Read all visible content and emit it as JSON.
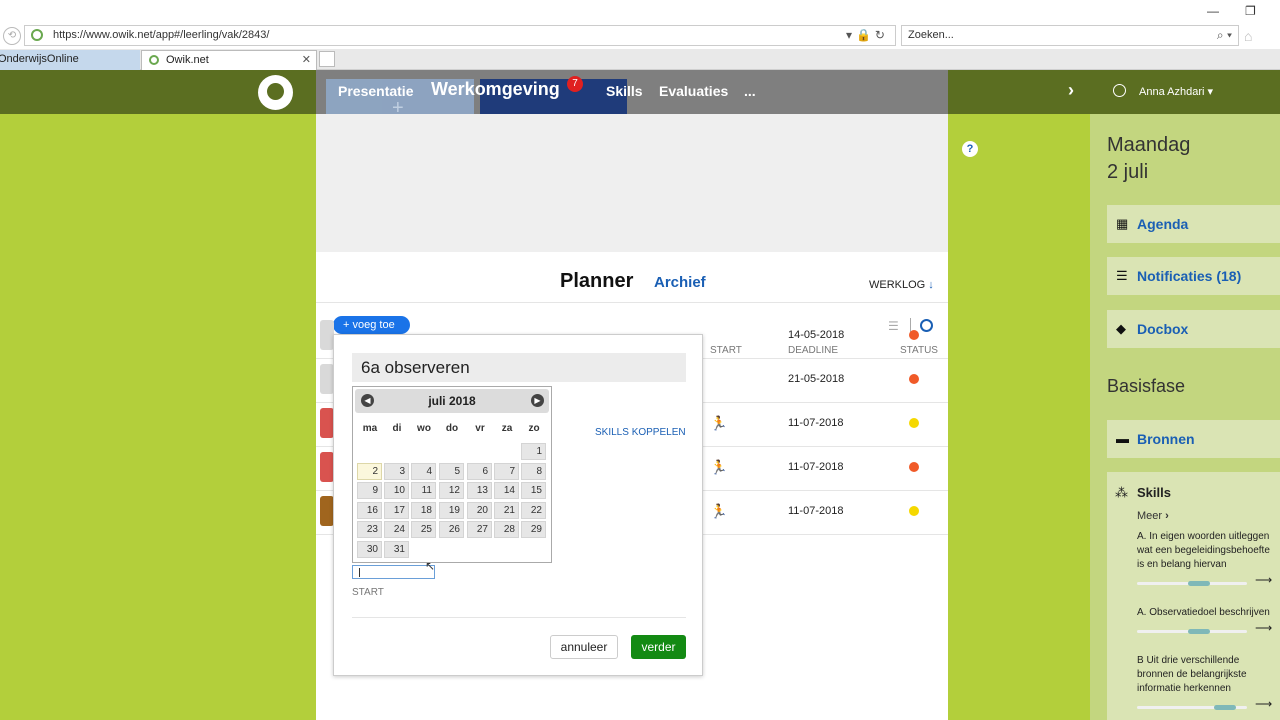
{
  "browser": {
    "url": "https://www.owik.net/app#/leerling/vak/2843/",
    "search_placeholder": "Zoeken...",
    "tabs": [
      {
        "label": "OnderwijsOnline"
      },
      {
        "label": "Owik.net"
      }
    ]
  },
  "nav": {
    "items": [
      "Presentatie",
      "Werkomgeving",
      "Skills",
      "Evaluaties",
      "..."
    ],
    "badge": "7"
  },
  "user": {
    "name": "Anna Azhdari"
  },
  "planner": {
    "title": "Planner",
    "archive": "Archief",
    "werklog": "WERKLOG",
    "add_button": "+ voeg toe",
    "columns": {
      "start": "START",
      "deadline": "DEADLINE",
      "status": "STATUS"
    },
    "rows": [
      {
        "deadline": "14-05-2018",
        "status_color": "#f05a28",
        "runner": false
      },
      {
        "deadline": "21-05-2018",
        "status_color": "#f05a28",
        "runner": false
      },
      {
        "deadline": "11-07-2018",
        "status_color": "#f5d800",
        "runner": true
      },
      {
        "deadline": "11-07-2018",
        "status_color": "#f05a28",
        "runner": true
      },
      {
        "deadline": "11-07-2018",
        "status_color": "#f5d800",
        "runner": true
      }
    ]
  },
  "modal": {
    "title_value": "6a observeren",
    "skills_link": "SKILLS KOPPELEN",
    "start_label": "START",
    "cancel": "annuleer",
    "next": "verder",
    "calendar": {
      "month": "juli 2018",
      "dow": [
        "ma",
        "di",
        "wo",
        "do",
        "vr",
        "za",
        "zo"
      ],
      "today": 2
    }
  },
  "sidebar": {
    "day": "Maandag",
    "date": "2 juli",
    "cards": [
      "Agenda",
      "Notificaties (18)",
      "Docbox"
    ],
    "section": "Basisfase",
    "bronnen": "Bronnen",
    "skills_title": "Skills",
    "meer": "Meer",
    "skills": [
      {
        "lines": [
          "A. In eigen woorden uitleggen",
          "wat een begeleidingsbehoefte",
          "is en belang hiervan"
        ],
        "level": 0.66
      },
      {
        "lines": [
          "A. Observatiedoel beschrijven"
        ],
        "level": 0.66
      },
      {
        "lines": [
          "B Uit drie verschillende",
          "bronnen de belangrijkste",
          "informatie herkennen"
        ],
        "level": 0.9
      }
    ]
  }
}
